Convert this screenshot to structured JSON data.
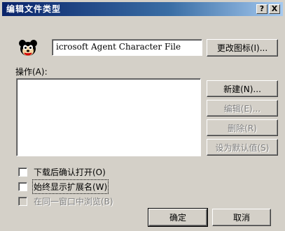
{
  "window": {
    "title": "编辑文件类型",
    "help_label": "?",
    "close_label": "X"
  },
  "filetype": {
    "icon": "agent-character-icon",
    "description": "icrosoft Agent Character File",
    "change_icon_button": "更改图标(I)..."
  },
  "actions": {
    "label": "操作(A):",
    "buttons": {
      "new": "新建(N)...",
      "edit": "编辑(E)...",
      "remove": "删除(R)",
      "set_default": "设为默认值(S)"
    }
  },
  "options": {
    "confirm_open": "下载后确认打开(O)",
    "always_show_ext": "始终显示扩展名(W)",
    "browse_same_window": "在同一窗口中浏览(B)"
  },
  "footer": {
    "ok": "确定",
    "cancel": "取消"
  },
  "colors": {
    "titlebar_start": "#0a246a",
    "titlebar_end": "#a6caf0",
    "face": "#d4d0c8"
  }
}
